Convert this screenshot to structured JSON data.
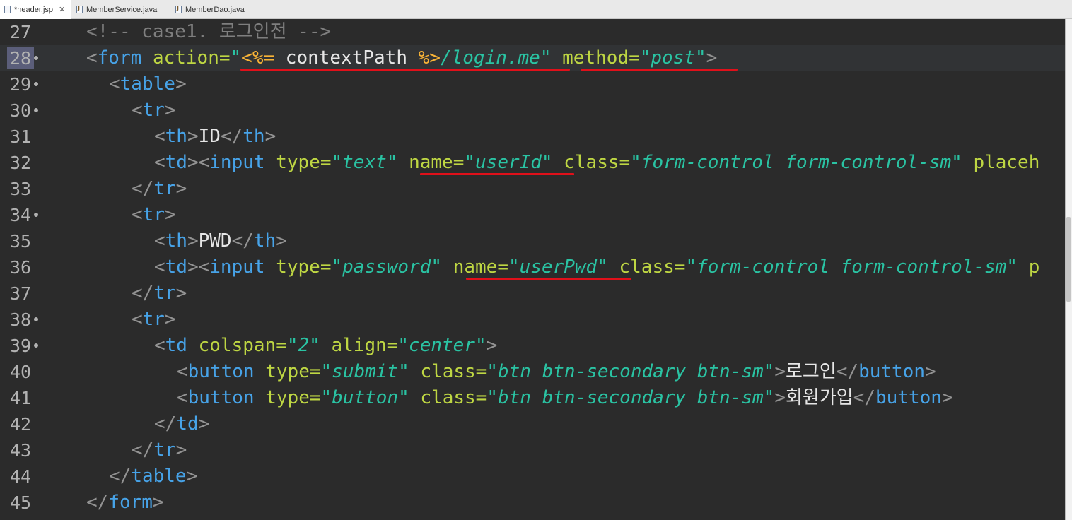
{
  "tabs": [
    {
      "label": "*header.jsp",
      "active": true,
      "icon": "jsp-file-icon",
      "close": "✕"
    },
    {
      "label": "MemberService.java",
      "active": false,
      "icon": "java-file-icon"
    },
    {
      "label": "MemberDao.java",
      "active": false,
      "icon": "java-file-icon"
    }
  ],
  "editor": {
    "current_line": "28",
    "lines": [
      {
        "n": "27",
        "parts": [
          "<!-- case1. 로그인전 -->"
        ]
      },
      {
        "n": "28",
        "parts": [
          "<",
          "form",
          "action=",
          "\"",
          "<%=",
          " contextPath ",
          "%>",
          "/login.me\"",
          "method=",
          "\"post\"",
          ">"
        ]
      },
      {
        "n": "29",
        "parts": [
          "<",
          "table",
          ">"
        ]
      },
      {
        "n": "30",
        "parts": [
          "<",
          "tr",
          ">"
        ]
      },
      {
        "n": "31",
        "parts": [
          "<",
          "th",
          ">",
          "ID",
          "</",
          "th",
          ">"
        ]
      },
      {
        "n": "32",
        "parts": [
          "<",
          "td",
          "><",
          "input",
          "type=",
          "\"text\"",
          "name=",
          "\"userId\"",
          "class=",
          "\"form-control form-control-sm\"",
          "placeh"
        ]
      },
      {
        "n": "33",
        "parts": [
          "</",
          "tr",
          ">"
        ]
      },
      {
        "n": "34",
        "parts": [
          "<",
          "tr",
          ">"
        ]
      },
      {
        "n": "35",
        "parts": [
          "<",
          "th",
          ">",
          "PWD",
          "</",
          "th",
          ">"
        ]
      },
      {
        "n": "36",
        "parts": [
          "<",
          "td",
          "><",
          "input",
          "type=",
          "\"password\"",
          "name=",
          "\"userPwd\"",
          "class=",
          "\"form-control form-control-sm\"",
          "p"
        ]
      },
      {
        "n": "37",
        "parts": [
          "</",
          "tr",
          ">"
        ]
      },
      {
        "n": "38",
        "parts": [
          "<",
          "tr",
          ">"
        ]
      },
      {
        "n": "39",
        "parts": [
          "<",
          "td",
          "colspan=",
          "\"2\"",
          "align=",
          "\"center\"",
          ">"
        ]
      },
      {
        "n": "40",
        "parts": [
          "<",
          "button",
          "type=",
          "\"submit\"",
          "class=",
          "\"btn btn-secondary btn-sm\"",
          ">",
          "로그인",
          "</",
          "button",
          ">"
        ]
      },
      {
        "n": "41",
        "parts": [
          "<",
          "button",
          "type=",
          "\"button\"",
          "class=",
          "\"btn btn-secondary btn-sm\"",
          ">",
          "회원가입",
          "</",
          "button",
          ">"
        ]
      },
      {
        "n": "42",
        "parts": [
          "</",
          "td",
          ">"
        ]
      },
      {
        "n": "43",
        "parts": [
          "</",
          "tr",
          ">"
        ]
      },
      {
        "n": "44",
        "parts": [
          "</",
          "table",
          ">"
        ]
      },
      {
        "n": "45",
        "parts": [
          "</",
          "form",
          ">"
        ]
      }
    ]
  },
  "colors": {
    "background": "#2b2b2b",
    "tag": "#47a3e8",
    "attribute": "#bed643",
    "value": "#2ac3a3",
    "jsp": "#f9b437",
    "comment": "#7f7f7f",
    "underline": "#e0101a"
  }
}
